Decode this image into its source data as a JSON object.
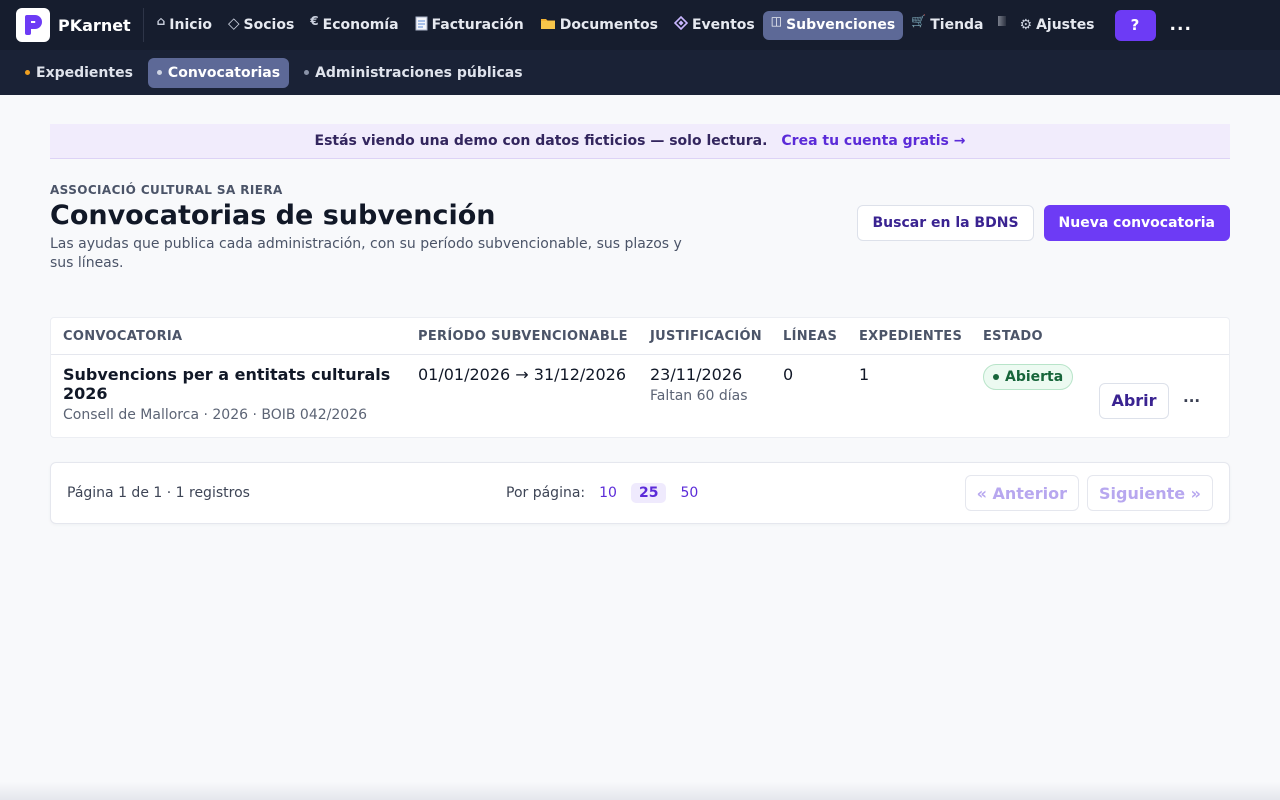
{
  "brand": {
    "name": "PKarnet",
    "logo_letter": "P",
    "logo_color": "#6d3bf5"
  },
  "nav": {
    "items": [
      {
        "label": "Inicio",
        "icon": "home-icon",
        "glyph": "⌂"
      },
      {
        "label": "Socios",
        "icon": "diamond-icon",
        "glyph": "◇"
      },
      {
        "label": "Economía",
        "icon": "euro-icon",
        "glyph": "€"
      },
      {
        "label": "Facturación",
        "icon": "receipt-icon",
        "glyph": ""
      },
      {
        "label": "Documentos",
        "icon": "folder-icon",
        "glyph": ""
      },
      {
        "label": "Eventos",
        "icon": "event-icon",
        "glyph": ""
      },
      {
        "label": "Subvenciones",
        "icon": "columns-icon",
        "glyph": "◫"
      },
      {
        "label": "Tienda",
        "icon": "cart-icon",
        "glyph": "🛒"
      },
      {
        "label": "Ajustes",
        "icon": "gear-icon",
        "glyph": "⚙"
      }
    ],
    "help_label": "?",
    "more_label": "..."
  },
  "subnav": {
    "items": [
      {
        "label": "Expedientes"
      },
      {
        "label": "Convocatorias"
      },
      {
        "label": "Administraciones públicas"
      }
    ]
  },
  "banner": {
    "text": "Estás viendo una demo con datos ficticios — solo lectura.",
    "link": "Crea tu cuenta gratis →"
  },
  "header": {
    "org": "ASSOCIACIÓ CULTURAL SA RIERA",
    "title": "Convocatorias de subvención",
    "subtitle": "Las ayudas que publica cada administración, con su período subvencionable, sus plazos y sus líneas.",
    "btn_search": "Buscar en la BDNS",
    "btn_new": "Nueva convocatoria"
  },
  "table": {
    "columns": [
      "CONVOCATORIA",
      "PERÍODO SUBVENCIONABLE",
      "JUSTIFICACIÓN",
      "LÍNEAS",
      "EXPEDIENTES",
      "ESTADO"
    ],
    "rows": [
      {
        "name": "Subvencions per a entitats culturals 2026",
        "meta": "Consell de Mallorca · 2026 · BOIB 042/2026",
        "period": "01/01/2026 → 31/12/2026",
        "justification": "23/11/2026",
        "justification_note": "Faltan 60 días",
        "lines": "0",
        "files": "1",
        "status": "Abierta",
        "open_label": "Abrir",
        "more_label": "···"
      }
    ]
  },
  "pager": {
    "info": "Página 1 de 1 · 1 registros",
    "per_page_label": "Por página:",
    "options": [
      "10",
      "25",
      "50"
    ],
    "selected": "25",
    "prev": "« Anterior",
    "next": "Siguiente »"
  },
  "colors": {
    "accent": "#6d3bf5",
    "nav_bg": "#161d2e",
    "active_nav": "#5d6997",
    "status_green": "#17653a"
  }
}
